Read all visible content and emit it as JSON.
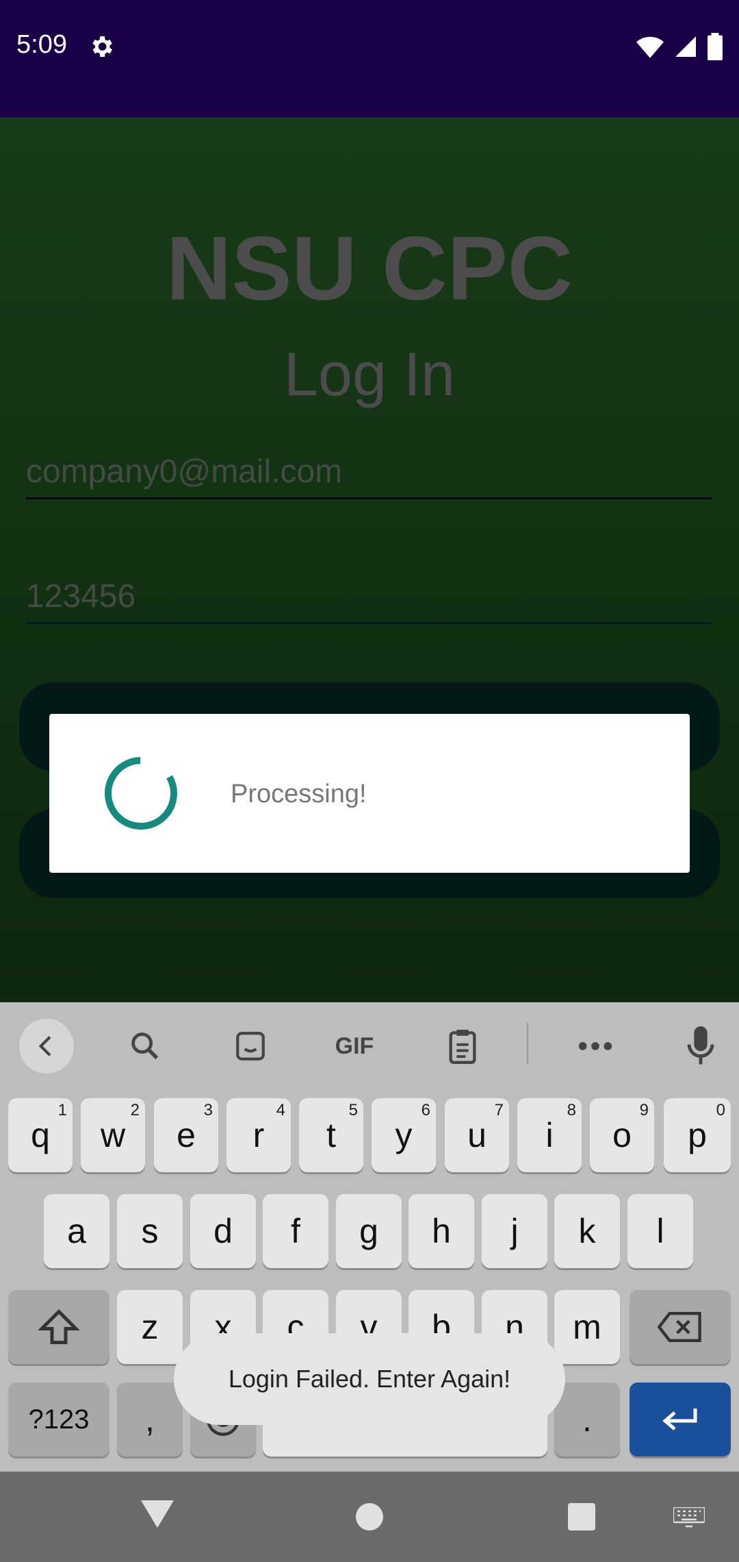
{
  "status_bar": {
    "time": "5:09"
  },
  "app": {
    "title": "NSU CPC",
    "subtitle": "Log In",
    "email_value": "company0@mail.com",
    "password_value": "123456"
  },
  "dialog": {
    "message": "Processing!"
  },
  "keyboard": {
    "row1": [
      {
        "key": "q",
        "hint": "1"
      },
      {
        "key": "w",
        "hint": "2"
      },
      {
        "key": "e",
        "hint": "3"
      },
      {
        "key": "r",
        "hint": "4"
      },
      {
        "key": "t",
        "hint": "5"
      },
      {
        "key": "y",
        "hint": "6"
      },
      {
        "key": "u",
        "hint": "7"
      },
      {
        "key": "i",
        "hint": "8"
      },
      {
        "key": "o",
        "hint": "9"
      },
      {
        "key": "p",
        "hint": "0"
      }
    ],
    "row2": [
      "a",
      "s",
      "d",
      "f",
      "g",
      "h",
      "j",
      "k",
      "l"
    ],
    "row3": [
      "z",
      "x",
      "c",
      "v",
      "b",
      "n",
      "m"
    ],
    "symbols_label": "?123",
    "comma": ",",
    "period": ".",
    "gif_label": "GIF"
  },
  "toast": {
    "message": "Login Failed. Enter Again!"
  },
  "colors": {
    "accent": "#168a7e",
    "status_bar": "#1a0047",
    "enter_key": "#1a4f9c"
  },
  "icons": [
    "settings-icon",
    "wifi-icon",
    "signal-icon",
    "battery-icon",
    "back-chevron-icon",
    "search-icon",
    "sticker-icon",
    "clipboard-icon",
    "more-icon",
    "mic-icon",
    "shift-icon",
    "backspace-icon",
    "enter-icon",
    "emoji-icon",
    "nav-back-icon",
    "nav-home-icon",
    "nav-recents-icon",
    "keyboard-icon"
  ]
}
